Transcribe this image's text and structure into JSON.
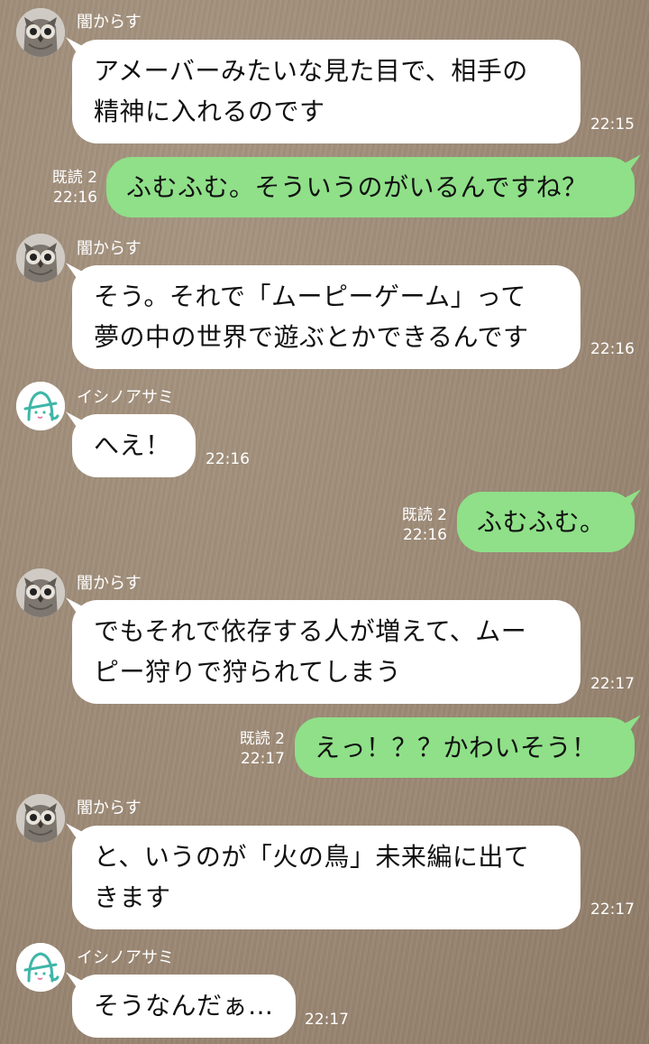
{
  "chat": {
    "contacts": {
      "yami": "闇からす",
      "ishino": "イシノアサミ"
    },
    "messages": [
      {
        "sender": "闇からす",
        "lines": [
          "アメーバーみたいな見た目で、相手の",
          "精神に入れるのです"
        ],
        "time": "22:15"
      },
      {
        "read": "既読 2",
        "lines": [
          "ふむふむ。そういうのがいるんですね？"
        ],
        "time": "22:16"
      },
      {
        "sender": "闇からす",
        "lines": [
          "そう。それで「ムーピーゲーム」って",
          "夢の中の世界で遊ぶとかできるんです"
        ],
        "time": "22:16"
      },
      {
        "sender": "イシノアサミ",
        "lines": [
          "へえ！"
        ],
        "time": "22:16"
      },
      {
        "read": "既読 2",
        "lines": [
          "ふむふむ。"
        ],
        "time": "22:16"
      },
      {
        "sender": "闇からす",
        "lines": [
          "でもそれで依存する人が増えて、ムー",
          "ピー狩りで狩られてしまう"
        ],
        "time": "22:17"
      },
      {
        "read": "既読 2",
        "lines": [
          "えっ！？？かわいそう！"
        ],
        "time": "22:17"
      },
      {
        "sender": "闇からす",
        "lines": [
          "と、いうのが「火の鳥」未来編に出て",
          "きます"
        ],
        "time": "22:17"
      },
      {
        "sender": "イシノアサミ",
        "lines": [
          "そうなんだぁ…"
        ],
        "time": "22:17"
      }
    ]
  },
  "icons": {
    "yami_avatar": "owl-avatar-icon",
    "ishino_avatar": "ghost-a-avatar-icon"
  },
  "colors": {
    "background": "#9d8a76",
    "incoming_bubble": "#ffffff",
    "outgoing_bubble": "#8fe088",
    "meta_text": "#ffffff",
    "ishino_logo": "#3fb6a8"
  }
}
